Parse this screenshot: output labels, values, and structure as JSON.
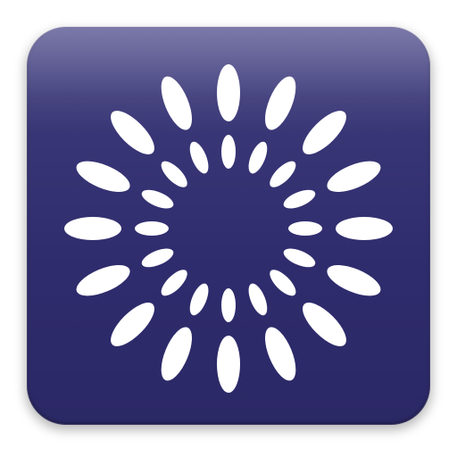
{
  "icon": {
    "name": "starburst-app-icon",
    "background_color": "#2f2c6d",
    "highlight_color": "#5f5d97",
    "petal_color": "#ffffff"
  }
}
